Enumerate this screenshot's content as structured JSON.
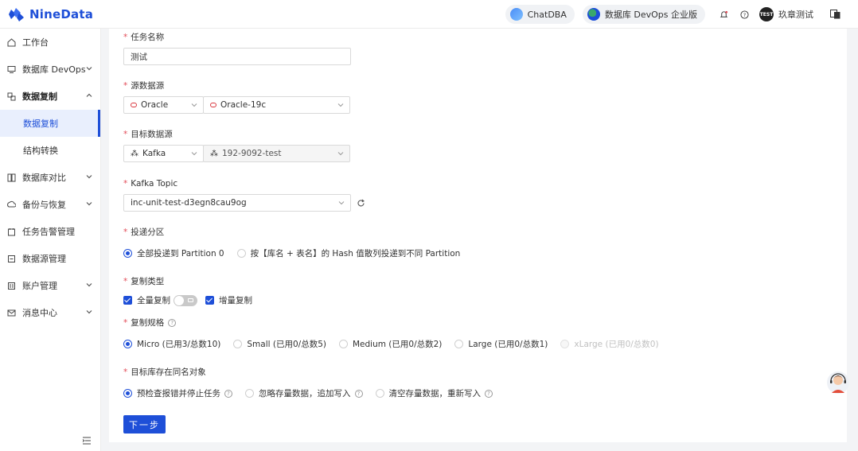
{
  "app": {
    "brand": "NineData",
    "colors": {
      "accent": "#1e4fd8",
      "required": "#e34d59"
    }
  },
  "header": {
    "chatdba_label": "ChatDBA",
    "devops_label": "数据库 DevOps 企业版",
    "user_badge": "TEST",
    "username": "玖章测试",
    "icons": [
      "bell-icon",
      "help-icon",
      "language-icon"
    ]
  },
  "sidebar": {
    "items": [
      {
        "label": "工作台",
        "icon": "workbench-icon"
      },
      {
        "label": "数据库 DevOps",
        "icon": "devops-icon"
      },
      {
        "label": "数据复制",
        "icon": "replication-icon",
        "expanded": true
      },
      {
        "label": "数据复制",
        "sub": true,
        "active": true
      },
      {
        "label": "结构转换",
        "sub": true
      },
      {
        "label": "数据库对比",
        "icon": "compare-icon"
      },
      {
        "label": "备份与恢复",
        "icon": "backup-icon"
      },
      {
        "label": "任务告警管理",
        "icon": "alarm-icon"
      },
      {
        "label": "数据源管理",
        "icon": "datasource-icon"
      },
      {
        "label": "账户管理",
        "icon": "account-icon"
      },
      {
        "label": "消息中心",
        "icon": "message-icon"
      }
    ]
  },
  "form": {
    "task_name": {
      "label": "任务名称",
      "value": "测试"
    },
    "source": {
      "label": "源数据源",
      "type": "Oracle",
      "instance": "Oracle-19c"
    },
    "target": {
      "label": "目标数据源",
      "type": "Kafka",
      "instance": "192-9092-test"
    },
    "topic": {
      "label": "Kafka Topic",
      "value": "inc-unit-test-d3egn8cau9og"
    },
    "partition": {
      "label": "投递分区",
      "options": [
        "全部投递到 Partition 0",
        "按【库名 + 表名】的 Hash 值散列投递到不同 Partition"
      ],
      "selected": 0
    },
    "copy_type": {
      "label": "复制类型",
      "full_label": "全量复制",
      "incremental_label": "增量复制"
    },
    "spec": {
      "label": "复制规格",
      "options": [
        "Micro (已用3/总数10)",
        "Small (已用0/总数5)",
        "Medium (已用0/总数2)",
        "Large (已用0/总数1)",
        "xLarge (已用0/总数0)"
      ],
      "selected": 0
    },
    "conflict": {
      "label": "目标库存在同名对象",
      "options": [
        "预检查报错并停止任务",
        "忽略存量数据，追加写入",
        "清空存量数据，重新写入"
      ],
      "selected": 0
    },
    "next_label": "下一步"
  }
}
